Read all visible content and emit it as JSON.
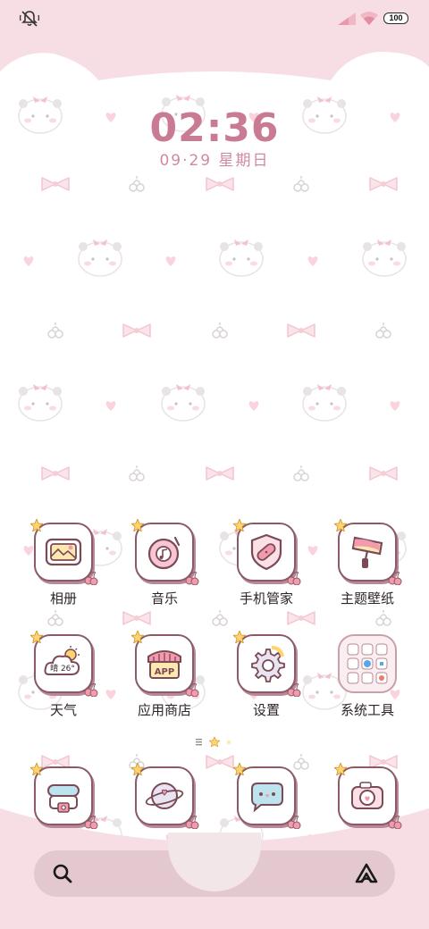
{
  "status_bar": {
    "battery": "100"
  },
  "lockclock": {
    "time": "02:36",
    "date": "09·29 星期日"
  },
  "apps_row1": [
    {
      "label": "相册"
    },
    {
      "label": "音乐"
    },
    {
      "label": "手机管家"
    },
    {
      "label": "主题壁纸"
    }
  ],
  "apps_row2": [
    {
      "label": "天气",
      "weather_text": "晴 26°"
    },
    {
      "label": "应用商店",
      "store_text": "APP"
    },
    {
      "label": "设置"
    },
    {
      "label": "系统工具"
    }
  ],
  "colors": {
    "accent": "#c87b93",
    "wallpaper_pink": "#f7dde4",
    "icon_border": "#8a5a66"
  }
}
